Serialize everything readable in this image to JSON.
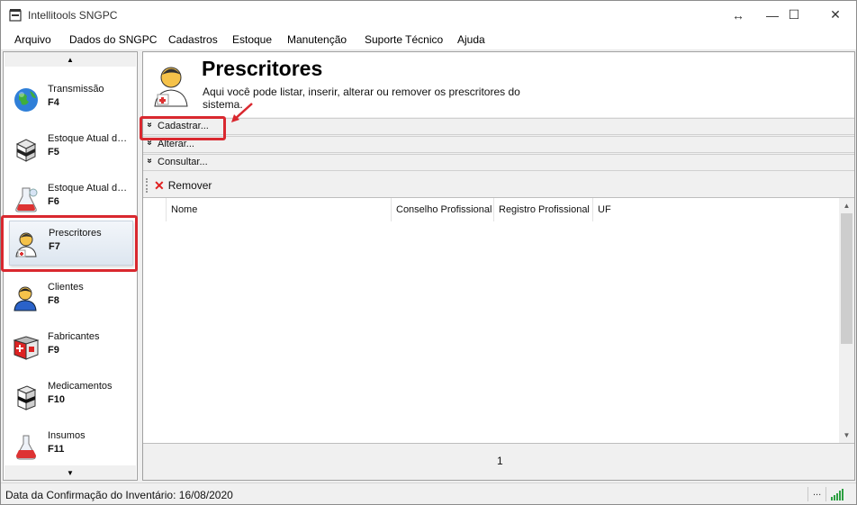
{
  "window": {
    "title": "Intellitools SNGPC",
    "resize_glyph": "↔",
    "minimize_glyph": "—",
    "maximize_glyph": "☐",
    "close_glyph": "✕"
  },
  "menu": [
    "Arquivo",
    "Dados do SNGPC",
    "Cadastros",
    "Estoque",
    "Manutenção",
    "Suporte Técnico",
    "Ajuda"
  ],
  "sidebar": {
    "items": [
      {
        "label": "Transmissão",
        "key": "F4",
        "icon": "globe-icon"
      },
      {
        "label": "Estoque Atual de Medicamentos",
        "key": "F5",
        "icon": "medicine-box-icon"
      },
      {
        "label": "Estoque Atual de Insumos",
        "key": "F6",
        "icon": "flask-icon"
      },
      {
        "label": "Prescritores",
        "key": "F7",
        "icon": "doctor-icon",
        "selected": true
      },
      {
        "label": "Clientes",
        "key": "F8",
        "icon": "client-icon"
      },
      {
        "label": "Fabricantes",
        "key": "F9",
        "icon": "factory-box-icon"
      },
      {
        "label": "Medicamentos",
        "key": "F10",
        "icon": "medicine-box-icon"
      },
      {
        "label": "Insumos",
        "key": "F11",
        "icon": "flask-icon"
      }
    ],
    "scroll_up_glyph": "▲",
    "scroll_down_glyph": "▼"
  },
  "page": {
    "title": "Prescritores",
    "description": "Aqui você pode listar, inserir, alterar ou remover os prescritores do sistema.",
    "sections": [
      {
        "label": "Cadastrar...",
        "chevron": "»"
      },
      {
        "label": "Alterar...",
        "chevron": "»"
      },
      {
        "label": "Consultar...",
        "chevron": "»"
      }
    ],
    "remove_label": "Remover",
    "remove_glyph": "✕",
    "columns": [
      "Nome",
      "Conselho Profissional",
      "Registro Profissional",
      "UF"
    ],
    "page_number": "1"
  },
  "status": {
    "text": "Data da Confirmação do Inventário: 16/08/2020",
    "dots": "...",
    "signal_color": "#2ea043"
  },
  "colors": {
    "highlight_red": "#d9282f",
    "selected_bg": "#dde6f0"
  }
}
